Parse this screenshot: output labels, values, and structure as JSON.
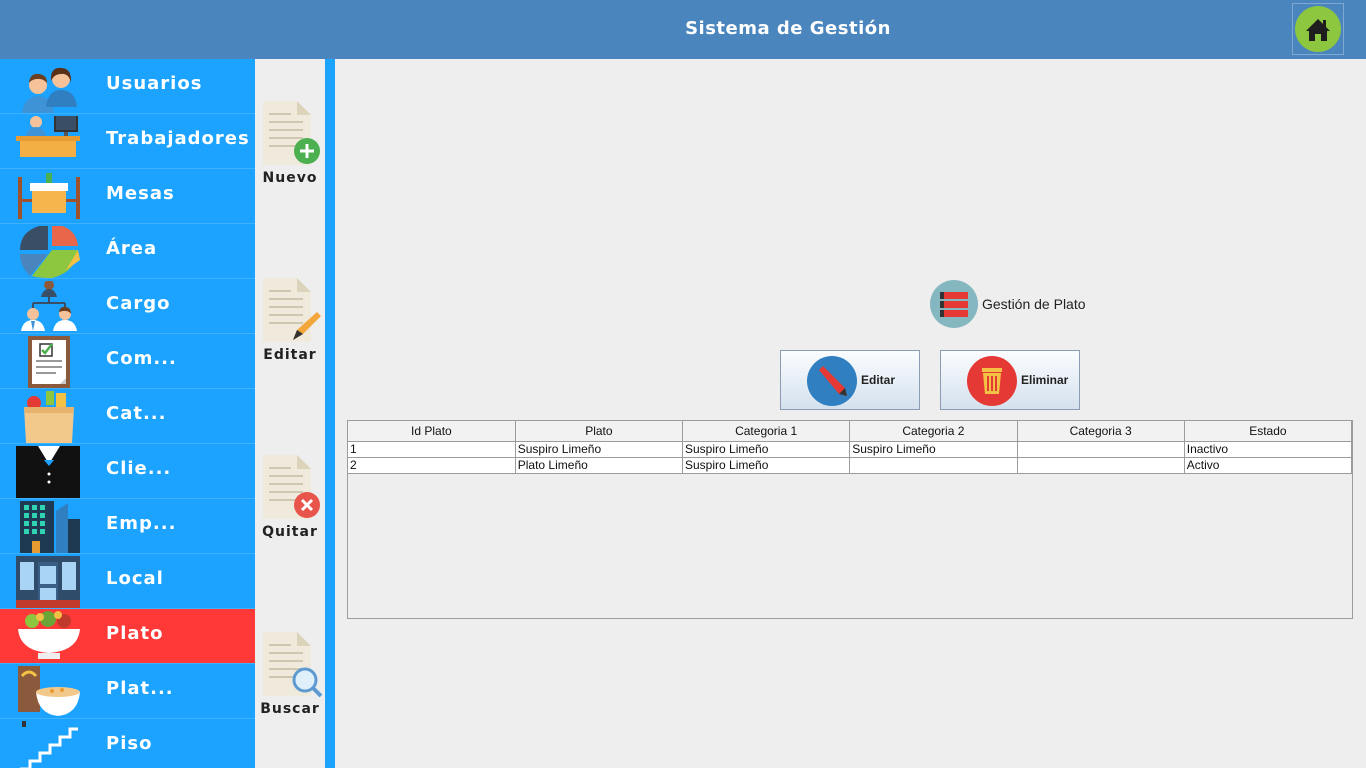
{
  "header": {
    "title": "Sistema de Gestión",
    "home_icon": "home-icon"
  },
  "sidebar": {
    "items": [
      {
        "label": "Usuarios",
        "icon": "users-icon"
      },
      {
        "label": "Trabajadores",
        "icon": "workers-icon"
      },
      {
        "label": "Mesas",
        "icon": "tables-icon"
      },
      {
        "label": "Área",
        "icon": "area-pie-icon"
      },
      {
        "label": "Cargo",
        "icon": "org-chart-icon"
      },
      {
        "label": "Com...",
        "icon": "clipboard-icon"
      },
      {
        "label": "Cat...",
        "icon": "grocery-bag-icon"
      },
      {
        "label": "Clie...",
        "icon": "tuxedo-icon"
      },
      {
        "label": "Emp...",
        "icon": "buildings-icon"
      },
      {
        "label": "Local",
        "icon": "storefront-icon"
      },
      {
        "label": "Plato",
        "icon": "salad-bowl-icon",
        "active": true
      },
      {
        "label": "Plat...",
        "icon": "bread-bowl-icon"
      },
      {
        "label": "Piso",
        "icon": "stairs-icon"
      }
    ]
  },
  "actions": {
    "new_label": "Nuevo",
    "edit_label": "Editar",
    "remove_label": "Quitar",
    "search_label": "Buscar"
  },
  "main": {
    "section_title": "Gestión de Plato",
    "edit_button": "Editar",
    "delete_button": "Eliminar"
  },
  "table": {
    "columns": [
      "Id Plato",
      "Plato",
      "Categoria 1",
      "Categoria 2",
      "Categoria 3",
      "Estado"
    ],
    "rows": [
      [
        "1",
        "Suspiro Limeño",
        "Suspiro Limeño",
        "Suspiro Limeño",
        "",
        "Inactivo"
      ],
      [
        "2",
        "Plato Limeño",
        "Suspiro Limeño",
        "",
        "",
        "Activo"
      ]
    ]
  },
  "colors": {
    "header": "#4a86bd",
    "sidebar": "#1ba3ff",
    "active": "#ff3838"
  }
}
